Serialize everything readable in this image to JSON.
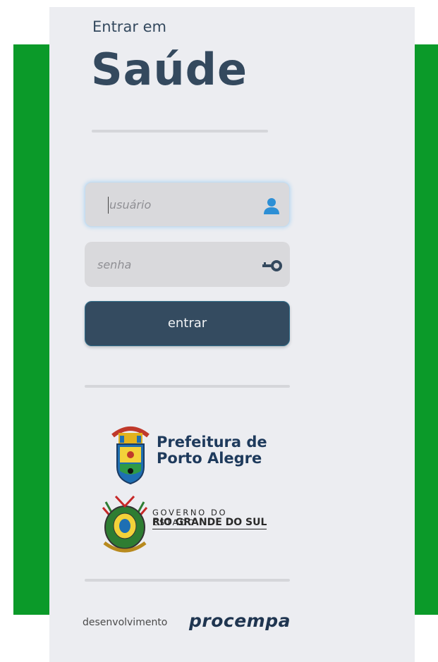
{
  "header": {
    "subtitle": "Entrar em",
    "title": "Saúde"
  },
  "login": {
    "username_placeholder": "usuário",
    "password_placeholder": "senha",
    "submit_label": "entrar",
    "username_icon": "user-icon",
    "password_icon": "key-icon"
  },
  "logos": {
    "prefeitura_line1": "Prefeitura de",
    "prefeitura_line2": "Porto Alegre",
    "estado_line1": "GOVERNO DO ESTADO",
    "estado_line2": "RIO GRANDE DO SUL"
  },
  "footer": {
    "dev_label": "desenvolvimento",
    "brand": "procempa"
  },
  "colors": {
    "green_band": "#0b9a29",
    "panel": "#ecedf1",
    "primary": "#344b60",
    "user_icon": "#2d8fd5"
  }
}
